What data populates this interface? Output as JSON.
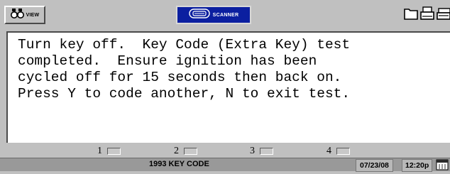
{
  "toolbar": {
    "view_label": "VIEW",
    "scanner_label": "SCANNER",
    "icons": [
      "binoculars-icon",
      "scanner-icon",
      "folder-icon",
      "printer-icon",
      "tools-icon"
    ]
  },
  "message": {
    "lines": [
      "Turn key off.  Key Code (Extra Key) test",
      "completed.  Ensure ignition has been",
      "cycled off for 15 seconds then back on.",
      "Press Y to code another, N to exit test."
    ]
  },
  "softkeys": [
    "1",
    "2",
    "3",
    "4"
  ],
  "status": {
    "title": "1993 KEY CODE",
    "date": "07/23/08",
    "time": "12:20p"
  },
  "colors": {
    "scanner_button": "#0b1fa0",
    "background": "#c0c0c0",
    "status_bar": "#999999"
  }
}
